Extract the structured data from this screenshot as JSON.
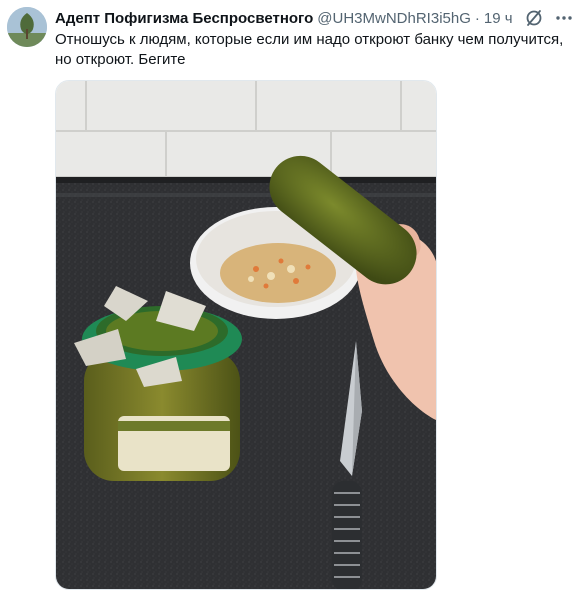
{
  "tweet": {
    "display_name": "Адепт Пофигизма Беспросветного",
    "handle": "@UH3MwNDhRI3i5hG",
    "separator": "·",
    "time": "19 ч",
    "text": "Отношусь к людям, которые если им надо откроют банку чем получится, но откроют. Бегите"
  },
  "icons": {
    "grok": "grok-icon",
    "more": "more-icon",
    "avatar": "avatar"
  },
  "colors": {
    "text": "#0f1419",
    "secondary": "#536471"
  }
}
